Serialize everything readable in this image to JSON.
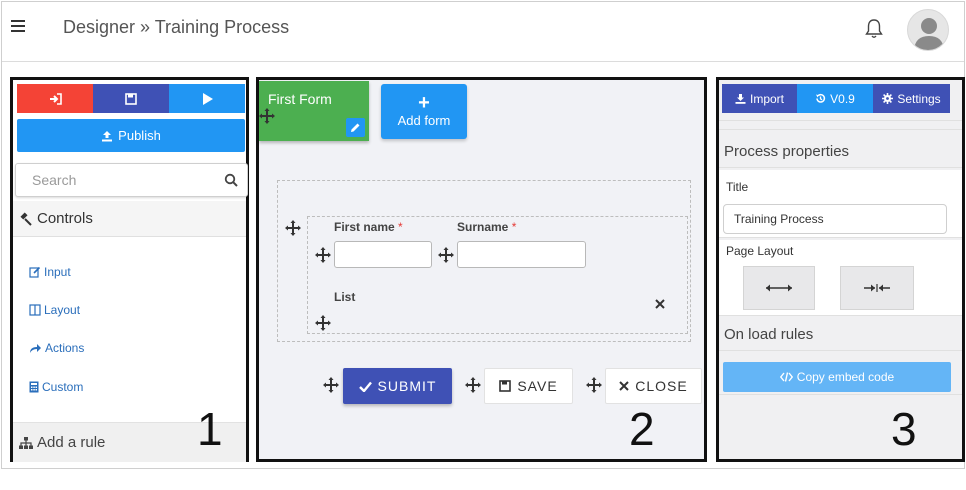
{
  "header": {
    "breadcrumb": "Designer » Training Process",
    "menu_icon": "hamburger-icon",
    "notification_icon": "bell-icon",
    "avatar_icon": "user-avatar-icon"
  },
  "left_panel": {
    "top_buttons": [
      {
        "icon": "sign-in-icon",
        "color": "#f44336"
      },
      {
        "icon": "floppy-disk-icon",
        "color": "#3f51b5"
      },
      {
        "icon": "play-icon",
        "color": "#2196f3"
      }
    ],
    "publish_label": "Publish",
    "search_placeholder": "Search",
    "controls_label": "Controls",
    "controls": [
      {
        "label": "Input",
        "icon": "edit-icon"
      },
      {
        "label": "Layout",
        "icon": "columns-icon"
      },
      {
        "label": "Actions",
        "icon": "share-icon"
      },
      {
        "label": "Custom",
        "icon": "calculator-icon"
      }
    ],
    "add_rule_label": "Add a rule",
    "panel_number": "1"
  },
  "center_panel": {
    "form_card_label": "First Form",
    "add_form_label": "Add form",
    "fields": {
      "first_name_label": "First name",
      "surname_label": "Surname",
      "required_marker": "*",
      "list_label": "List"
    },
    "buttons": {
      "submit": "SUBMIT",
      "save": "SAVE",
      "close": "CLOSE"
    },
    "panel_number": "2"
  },
  "right_panel": {
    "top_buttons": [
      {
        "label": "Import",
        "icon": "download-icon",
        "color": "#3f51b5"
      },
      {
        "label": "V0.9",
        "icon": "history-icon",
        "color": "#2196f3"
      },
      {
        "label": "Settings",
        "icon": "gear-icon",
        "color": "#3f51b5"
      }
    ],
    "process_properties_label": "Process properties",
    "title_label": "Title",
    "title_value": "Training Process",
    "page_layout_label": "Page Layout",
    "on_load_rules_label": "On load rules",
    "copy_embed_label": "Copy embed code",
    "panel_number": "3"
  },
  "colors": {
    "blue": "#2196f3",
    "indigo": "#3f51b5",
    "red": "#f44336",
    "green": "#4caf50",
    "light_blue": "#64b5f6"
  }
}
